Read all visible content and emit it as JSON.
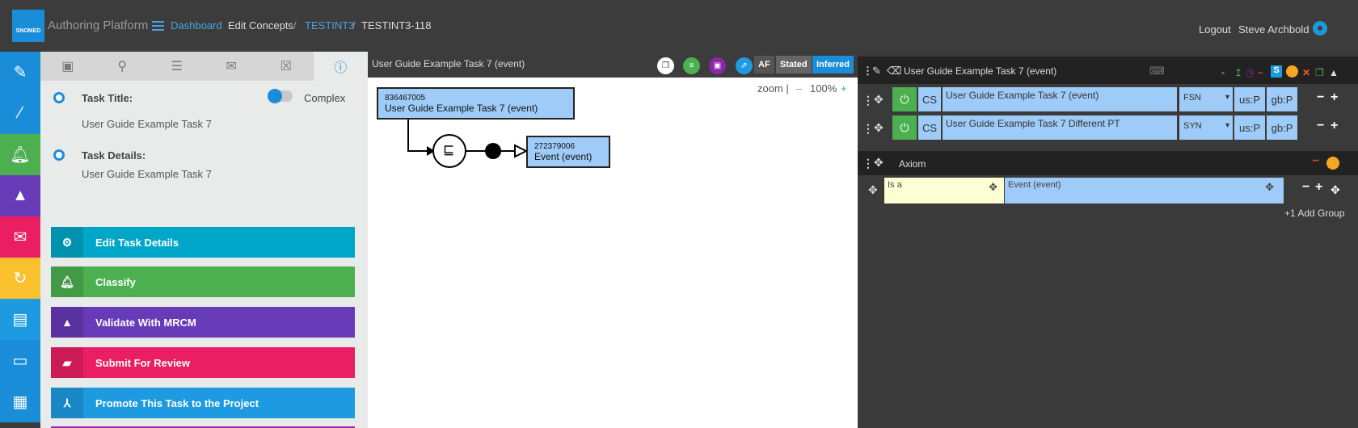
{
  "header": {
    "logo_text": "SNOMED",
    "app_title": "Authoring Platform",
    "breadcrumb": {
      "dashboard": "Dashboard",
      "edit_concepts": "Edit Concepts",
      "sep1": "/",
      "project": "TESTINT3",
      "sep2": "/",
      "task": "TESTINT3-118"
    },
    "logout": "Logout",
    "user": "Steve Archbold"
  },
  "task": {
    "title_label": "Task Title:",
    "complex_label": "Complex",
    "title_value": "User Guide Example Task 7",
    "details_label": "Task Details:",
    "details_value": "User Guide Example Task 7"
  },
  "actions": {
    "edit": "Edit Task Details",
    "classify": "Classify",
    "validate": "Validate With MRCM",
    "submit": "Submit For Review",
    "promote": "Promote This Task to the Project"
  },
  "diagram": {
    "title": "User Guide Example Task 7 (event)",
    "af": "AF",
    "stated": "Stated",
    "inferred": "Inferred",
    "zoom_label": "zoom |",
    "zoom_minus": "–",
    "zoom_value": "100%",
    "zoom_plus": "+",
    "concept_id": "836467005",
    "concept_term": "User Guide Example Task 7 (event)",
    "parent_id": "272379006",
    "parent_term": "Event (event)",
    "subsumption_symbol": "⊑"
  },
  "editor": {
    "title": "User Guide Example Task 7 (event)",
    "descriptions": [
      {
        "cs": "CS",
        "term": "User Guide Example Task 7 (event)",
        "type": "FSN",
        "us": "us:P",
        "gb": "gb:P"
      },
      {
        "cs": "CS",
        "term": "User Guide Example Task 7 Different PT",
        "type": "SYN",
        "us": "us:P",
        "gb": "gb:P"
      }
    ],
    "axiom_label": "Axiom",
    "relationship_type": "Is a",
    "relationship_target": "Event (event)",
    "add_group": "+1 Add Group"
  },
  "colors": {
    "primary": "#1a8dd8",
    "green": "#4caf50",
    "purple": "#673ab7",
    "pink": "#e91e63",
    "amber": "#fbc02d",
    "light_blue": "#1e9be0"
  }
}
